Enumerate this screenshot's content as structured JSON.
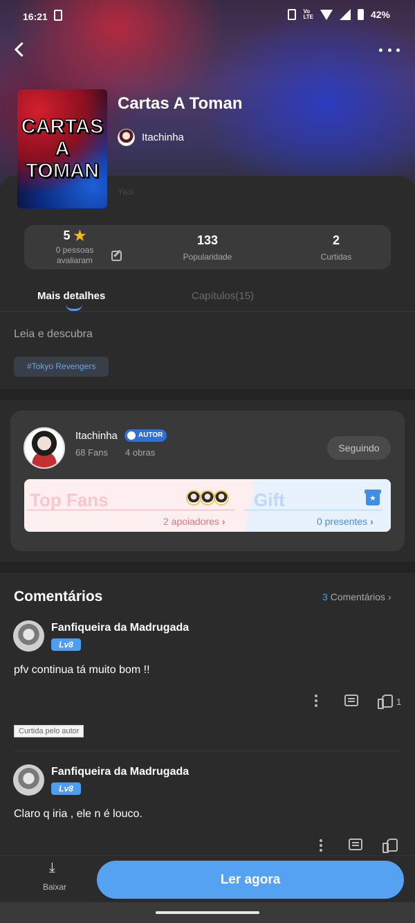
{
  "status_bar": {
    "time": "16:21",
    "lte": "Vo\nLTE",
    "battery": "42%"
  },
  "book": {
    "cover_text": "CARTAS\nA\nTOMAN",
    "title": "Cartas A Toman",
    "author": "Itachinha",
    "genre": "Yaoi"
  },
  "stats": {
    "rating": "5",
    "rating_label": "0 pessoas avaliaram",
    "popularity": "133",
    "popularity_label": "Popularidade",
    "likes": "2",
    "likes_label": "Curtidas"
  },
  "tabs": {
    "details": "Mais detalhes",
    "chapters": "Capítulos(15)"
  },
  "description": "Leia e descubra",
  "tag": "#Tokyo Revengers",
  "author_card": {
    "name": "Itachinha",
    "badge": "AUTOR",
    "fans": "68 Fans",
    "works": "4 obras",
    "follow": "Seguindo",
    "top_fans": "Top Fans",
    "supporters": "2 apoiadores",
    "gift": "Gift",
    "presents": "0 presentes"
  },
  "comments": {
    "title": "Comentários",
    "count": "3",
    "count_label": "Comentários",
    "items": [
      {
        "user": "Fanfiqueira da Madrugada",
        "level": "Lv8",
        "text": "pfv continua tá muito bom !!",
        "likes": "1",
        "liked_by_author": "Curtida pelo autor"
      },
      {
        "user": "Fanfiqueira da Madrugada",
        "level": "Lv8",
        "text": "Claro q iria , ele n é louco."
      }
    ]
  },
  "bottom": {
    "download": "Baixar",
    "read": "Ler agora"
  },
  "colors": {
    "accent": "#4f9df2",
    "star": "#f5b71b",
    "background": "#2b2b2b"
  }
}
